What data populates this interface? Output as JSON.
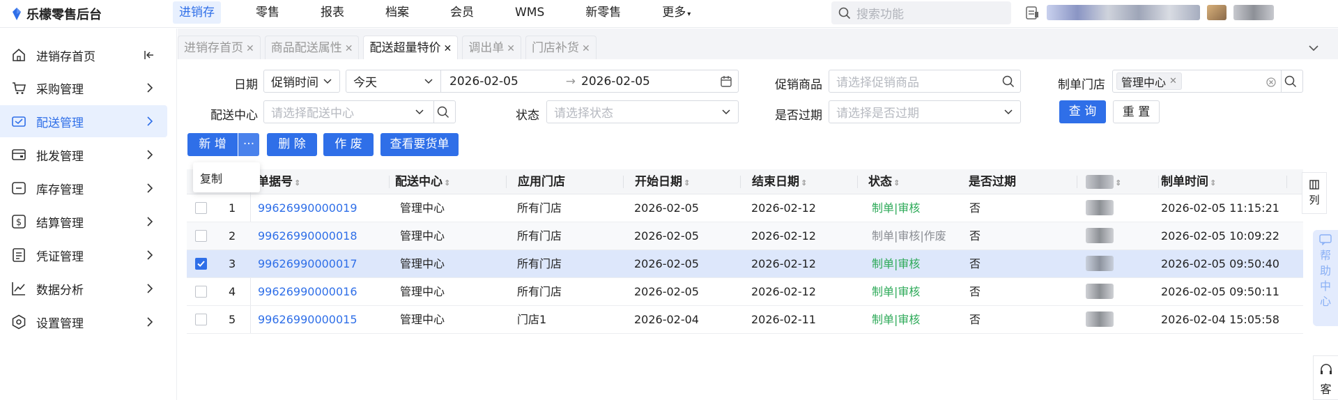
{
  "app": {
    "title": "乐檬零售后台"
  },
  "topnav": {
    "items": [
      "进销存",
      "零售",
      "报表",
      "档案",
      "会员",
      "WMS",
      "新零售",
      "更多"
    ],
    "active": "进销存"
  },
  "search": {
    "placeholder": "搜索功能"
  },
  "sidebar": {
    "home": "进销存首页",
    "items": [
      {
        "label": "采购管理",
        "icon": "cart-icon"
      },
      {
        "label": "配送管理",
        "icon": "truck-icon",
        "active": true
      },
      {
        "label": "批发管理",
        "icon": "wallet-icon"
      },
      {
        "label": "库存管理",
        "icon": "box-icon"
      },
      {
        "label": "结算管理",
        "icon": "dollar-icon"
      },
      {
        "label": "凭证管理",
        "icon": "document-icon"
      },
      {
        "label": "数据分析",
        "icon": "chart-icon"
      },
      {
        "label": "设置管理",
        "icon": "settings-icon"
      }
    ]
  },
  "tabs": [
    {
      "label": "进销存首页",
      "active": false
    },
    {
      "label": "商品配送属性",
      "active": false
    },
    {
      "label": "配送超量特价",
      "active": true
    },
    {
      "label": "调出单",
      "active": false
    },
    {
      "label": "门店补货",
      "active": false
    }
  ],
  "filters": {
    "date_label": "日期",
    "date_type": "促销时间",
    "date_range": "今天",
    "start_date": "2026-02-05",
    "arrow": "→",
    "end_date": "2026-02-05",
    "promo_label": "促销商品",
    "promo_placeholder": "请选择促销商品",
    "store_label": "制单门店",
    "store_tag": "管理中心",
    "center_label": "配送中心",
    "center_placeholder": "请选择配送中心",
    "status_label": "状态",
    "status_placeholder": "请选择状态",
    "expired_label": "是否过期",
    "expired_placeholder": "请选择是否过期",
    "query": "查 询",
    "reset": "重 置"
  },
  "actions": {
    "add": "新 增",
    "more": "···",
    "delete": "删 除",
    "void": "作 废",
    "view_order": "查看要货单",
    "dropdown_copy": "复制"
  },
  "table": {
    "headers": [
      "单据号",
      "配送中心",
      "应用门店",
      "开始日期",
      "结束日期",
      "状态",
      "是否过期",
      "",
      "制单时间"
    ],
    "colset": "列",
    "rows": [
      {
        "idx": "1",
        "no": "99626990000019",
        "center": "管理中心",
        "store": "所有门店",
        "start": "2026-02-05",
        "end": "2026-02-12",
        "status": "制单|审核",
        "status_color": "green",
        "expired": "否",
        "time": "2026-02-05 11:15:21",
        "checked": false
      },
      {
        "idx": "2",
        "no": "99626990000018",
        "center": "管理中心",
        "store": "所有门店",
        "start": "2026-02-05",
        "end": "2026-02-12",
        "status": "制单|审核|作废",
        "status_color": "gray",
        "expired": "否",
        "time": "2026-02-05 10:09:22",
        "checked": false
      },
      {
        "idx": "3",
        "no": "99626990000017",
        "center": "管理中心",
        "store": "所有门店",
        "start": "2026-02-05",
        "end": "2026-02-12",
        "status": "制单|审核",
        "status_color": "green",
        "expired": "否",
        "time": "2026-02-05 09:50:40",
        "checked": true
      },
      {
        "idx": "4",
        "no": "99626990000016",
        "center": "管理中心",
        "store": "所有门店",
        "start": "2026-02-05",
        "end": "2026-02-12",
        "status": "制单|审核",
        "status_color": "green",
        "expired": "否",
        "time": "2026-02-05 09:50:11",
        "checked": false
      },
      {
        "idx": "5",
        "no": "99626990000015",
        "center": "管理中心",
        "store": "门店1",
        "start": "2026-02-04",
        "end": "2026-02-11",
        "status": "制单|审核",
        "status_color": "green",
        "expired": "否",
        "time": "2026-02-04 15:05:58",
        "checked": false
      }
    ]
  },
  "help": {
    "label": [
      "帮",
      "助",
      "中",
      "心"
    ],
    "kefu": "客"
  },
  "colors": {
    "accent": "#2f6fe8",
    "active_bg": "#e8f0fe",
    "green": "#2eaa59"
  }
}
